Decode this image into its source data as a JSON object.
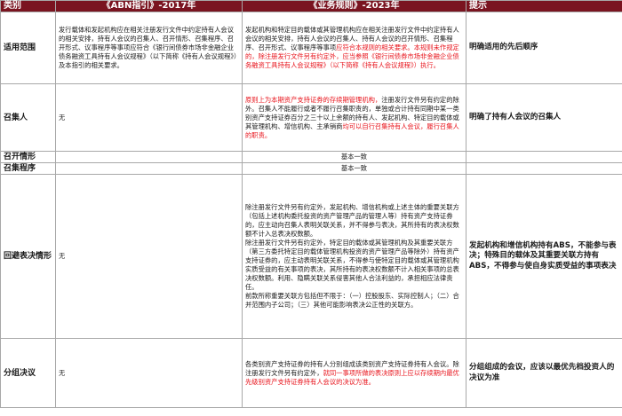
{
  "header": {
    "col1": "类别",
    "col2": "《ABN指引》-2017年",
    "col3": "《业务规则》-2023年",
    "col4": "提示"
  },
  "rows": [
    {
      "category": "适用范围",
      "abn": "发行载体和发起机构应在相关注册发行文件中约定持有人会议的相关安排，持有人会议的召集人、召开情形、召集程序、召开形式、议事程序等事项应符合《银行间债券市场非金融企业债务融资工具持有人会议规程》（以下简称《持有人会议规程》）及本指引的相关要求。",
      "rule_black": "发起机构和特定目的载体或其管理机构应在相关注册发行文件中约定持有人会议的相关安排，持有人会议的召集人、持有人会议的召开情形、召集程序、召开形式、议事程序等事项",
      "rule_red": "应符合本规则的相关要求。本规则未作规定的，除注册发行文件另有约定外，应当参照《银行间债券市场非金融企业债务融资工具持有人会议规程》（以下简称《持有人会议规程》）执行。",
      "note": "明确适用的先后顺序"
    },
    {
      "category": "召集人",
      "abn": "无",
      "rule_red1": "原则上为本期资产支持证券的存续期管理机构，",
      "rule_black": "注册发行文件另有约定的除外。召集人不能履行或者不履行召集职责的，单独或合计持有同期中某一类别资产支持证券百分之三十以上余额的持有人、发起机构、特定目的载体或其管理机构、增信机构、主承销商",
      "rule_red2": "均可以自行召集持有人会议，履行召集人的职责。",
      "note": "明确了持有人会议的召集人"
    },
    {
      "category": "召开情形",
      "abn": "",
      "rule": "基本一致",
      "note": ""
    },
    {
      "category": "召集程序",
      "abn": "",
      "rule": "基本一致",
      "note": ""
    },
    {
      "category": "回避表决情形",
      "abn": "无",
      "rule": "除注册发行文件另有约定外，发起机构、增信机构或上述主体的重要关联方（包括上述机构委托投资的资产管理产品的管理人等）持有资产支持证券的，应主动向召集人表明关联关系，并不得参与表决，其所持有的表决权数额不计入总表决权数额。\n除注册发行文件另有约定外，特定目的载体或其管理机构及其重要关联方（第三方委托特定目的载体管理机构投资的资产管理产品等除外）持有资产支持证券的，应主动表明关联关系，不得参与使特定目的载体或其管理机构实质受益的有关事项的表决，其所持有的表决权数额不计入相关事项的总表决权数额。利用、隐瞒关联关系侵害其他人合法利益的，承担相应法律责任。\n前款所称重要关联方包括但不限于：（一）控股股东、实际控制人；（二）合并范围内子公司；（三）其他可能影响表决公正性的关联方。",
      "note": "发起机构和增信机构持有ABS，不能参与表决；特殊目的载体及其重要关联方持有ABS，不得参与使自身实质受益的事项表决"
    },
    {
      "category": "分组决议",
      "abn": "无",
      "rule_black": "各类别资产支持证券的持有人分别组成该类别资产支持证券持有人会议。除注册发行文件另有约定外，",
      "rule_red": "就同一事项所做的表决原则上应以存续期内最优先级别资产支持证券持有人会议的决议为准。",
      "note": "分组组成的会议，应该以最优先档投资人的决议为准"
    }
  ]
}
